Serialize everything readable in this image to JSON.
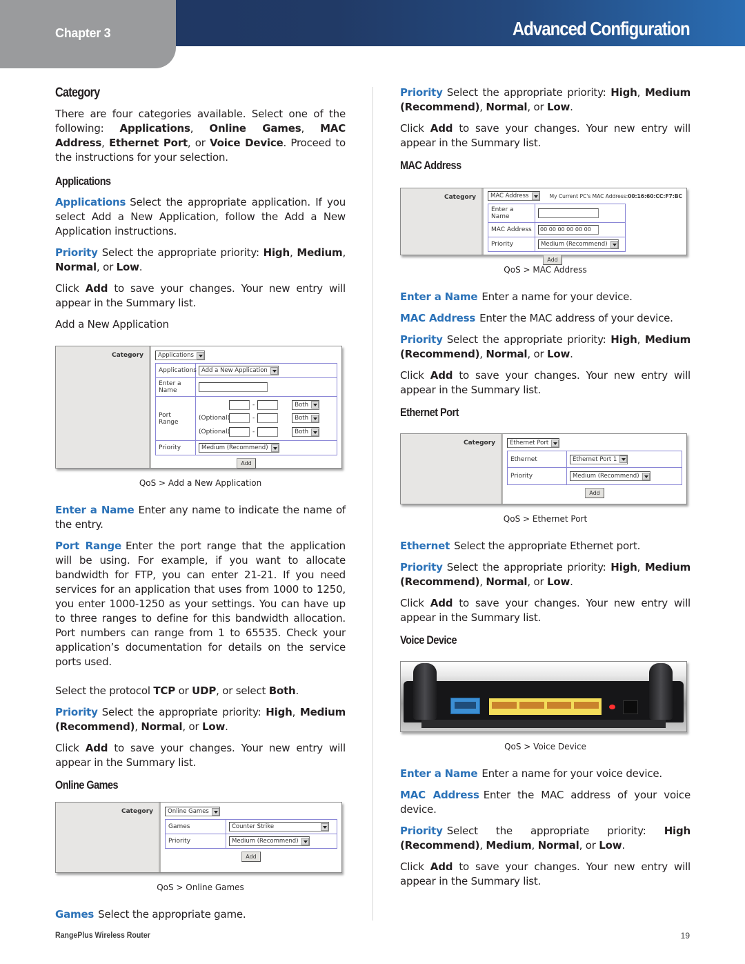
{
  "header": {
    "chapter": "Chapter 3",
    "title": "Advanced Configuration"
  },
  "colors": {
    "accent_blue": "#2b72b8",
    "header_dark": "#1f3560",
    "chapter_tab": "#9a9b9d"
  },
  "left": {
    "category_heading": "Category",
    "category_intro": {
      "pre": "There are four categories available. Select one of the following: ",
      "items": [
        "Applications",
        "Online Games",
        "MAC Address",
        "Ethernet Port",
        "Voice Device"
      ],
      "sep1": ", ",
      "sep2": ", ",
      "sep3": ", ",
      "sep4": ", or ",
      "post": ". Proceed to the instructions for your selection."
    },
    "applications_heading": "Applications",
    "app_desc": {
      "term": "Applications",
      "text": "Select the appropriate application. If you select Add a New Application, follow the Add a New Application instructions."
    },
    "app_priority": {
      "term": "Priority",
      "text": "Select the appropriate priority: ",
      "b1": "High",
      "s1": ", ",
      "b2": "Medium",
      "s2": ", ",
      "b3": "Normal",
      "s3": ", or ",
      "b4": "Low",
      "end": "."
    },
    "app_click": {
      "pre": "Click ",
      "b": "Add",
      "post": " to save your changes. Your new entry will appear in the Summary list."
    },
    "add_new_app": "Add a New Application",
    "shot_app": {
      "category_label": "Category",
      "category_value": "Applications",
      "rows": {
        "applications_label": "Applications",
        "applications_value": "Add a New Application",
        "name_label": "Enter a Name",
        "name_value": "",
        "port_range_label": "Port Range",
        "optional_label": "(Optional)",
        "dash": "-",
        "protocol_value": "Both",
        "priority_label": "Priority",
        "priority_value": "Medium (Recommend)"
      },
      "add_button": "Add"
    },
    "caption_app": "QoS > Add a New Application",
    "enter_name": {
      "term": "Enter a Name",
      "text": "Enter any name to indicate the name of the entry."
    },
    "port_range": {
      "term": "Port Range",
      "text": "Enter the port range that the application will be using. For example, if you want to allocate bandwidth for FTP, you can enter 21-21. If you need services for an application that uses from 1000 to 1250, you enter 1000-1250 as your settings. You can have up to three ranges to define for this bandwidth allocation. Port numbers can range from 1 to 65535. Check your application’s documentation for details on the service ports used."
    },
    "protocol": {
      "pre": "Select the protocol ",
      "b1": "TCP",
      "s1": " or ",
      "b2": "UDP",
      "s2": ", or select ",
      "b3": "Both",
      "end": "."
    },
    "priority2": {
      "term": "Priority",
      "text": "Select the appropriate priority: ",
      "b1": "High",
      "s1": ", ",
      "b2": "Medium (Recommend)",
      "s2": ", ",
      "b3": "Normal",
      "s3": ", or ",
      "b4": "Low",
      "end": "."
    },
    "click2": {
      "pre": "Click ",
      "b": "Add",
      "post": " to save your changes. Your new entry will appear in the Summary list."
    },
    "online_games_heading": "Online Games",
    "shot_games": {
      "category_label": "Category",
      "category_value": "Online Games",
      "games_label": "Games",
      "games_value": "Counter Strike",
      "priority_label": "Priority",
      "priority_value": "Medium (Recommend)",
      "add_button": "Add"
    },
    "caption_games": "QoS > Online Games",
    "games_desc": {
      "term": "Games",
      "text": "Select the appropriate game."
    }
  },
  "right": {
    "priority_top": {
      "term": "Priority",
      "text": "Select the appropriate priority: ",
      "b1": "High",
      "s1": ", ",
      "b2": "Medium (Recommend)",
      "s2": ", ",
      "b3": "Normal",
      "s3": ", or ",
      "b4": "Low",
      "end": "."
    },
    "click_top": {
      "pre": "Click ",
      "b": "Add",
      "post": " to save your changes. Your new entry will appear in the Summary list."
    },
    "mac_heading": "MAC Address",
    "shot_mac": {
      "category_label": "Category",
      "category_value": "MAC Address",
      "current_mac_label": "My Current PC's MAC Address:",
      "current_mac_value": "00:16:60:CC:F7:BC",
      "name_label": "Enter a Name",
      "name_value": "",
      "mac_label": "MAC Address",
      "mac_value": "00 00 00 00 00 00",
      "priority_label": "Priority",
      "priority_value": "Medium (Recommend)",
      "add_button": "Add"
    },
    "caption_mac": "QoS > MAC Address",
    "mac_enter_name": {
      "term": "Enter a Name",
      "text": "Enter a name for your device."
    },
    "mac_address": {
      "term": "MAC Address",
      "text": "Enter the MAC address of your device."
    },
    "mac_priority": {
      "term": "Priority",
      "text": "Select the appropriate priority: ",
      "b1": "High",
      "s1": ", ",
      "b2": "Medium (Recommend)",
      "s2": ", ",
      "b3": "Normal",
      "s3": ", or ",
      "b4": "Low",
      "end": "."
    },
    "mac_click": {
      "pre": "Click ",
      "b": "Add",
      "post": " to save your changes. Your new entry will appear in the Summary list."
    },
    "eth_heading": "Ethernet Port",
    "shot_eth": {
      "category_label": "Category",
      "category_value": "Ethernet Port",
      "ethernet_label": "Ethernet",
      "ethernet_value": "Ethernet Port 1",
      "priority_label": "Priority",
      "priority_value": "Medium (Recommend)",
      "add_button": "Add"
    },
    "caption_eth": "QoS > Ethernet Port",
    "eth_desc": {
      "term": "Ethernet",
      "text": "Select the appropriate Ethernet port."
    },
    "eth_priority": {
      "term": "Priority",
      "text": "Select the appropriate priority: ",
      "b1": "High",
      "s1": ", ",
      "b2": "Medium (Recommend)",
      "s2": ", ",
      "b3": "Normal",
      "s3": ", or ",
      "b4": "Low",
      "end": "."
    },
    "eth_click": {
      "pre": "Click ",
      "b": "Add",
      "post": " to save your changes. Your new entry will appear in the Summary list."
    },
    "voice_heading": "Voice Device",
    "caption_voice": "QoS > Voice Device",
    "voice_name": {
      "term": "Enter a Name",
      "text": "Enter a name for your voice device."
    },
    "voice_mac": {
      "term": "MAC Address",
      "text": "Enter the MAC address of your voice device."
    },
    "voice_priority": {
      "term": "Priority",
      "text": "Select the appropriate priority: ",
      "b1": "High (Recommend)",
      "s1": ", ",
      "b2": "Medium",
      "s2": ", ",
      "b3": "Normal",
      "s3": ", or ",
      "b4": "Low",
      "end": "."
    },
    "voice_click": {
      "pre": "Click ",
      "b": "Add",
      "post": " to save your changes. Your new entry will appear in the Summary list."
    }
  },
  "footer": {
    "product": "RangePlus Wireless Router",
    "page": "19"
  }
}
